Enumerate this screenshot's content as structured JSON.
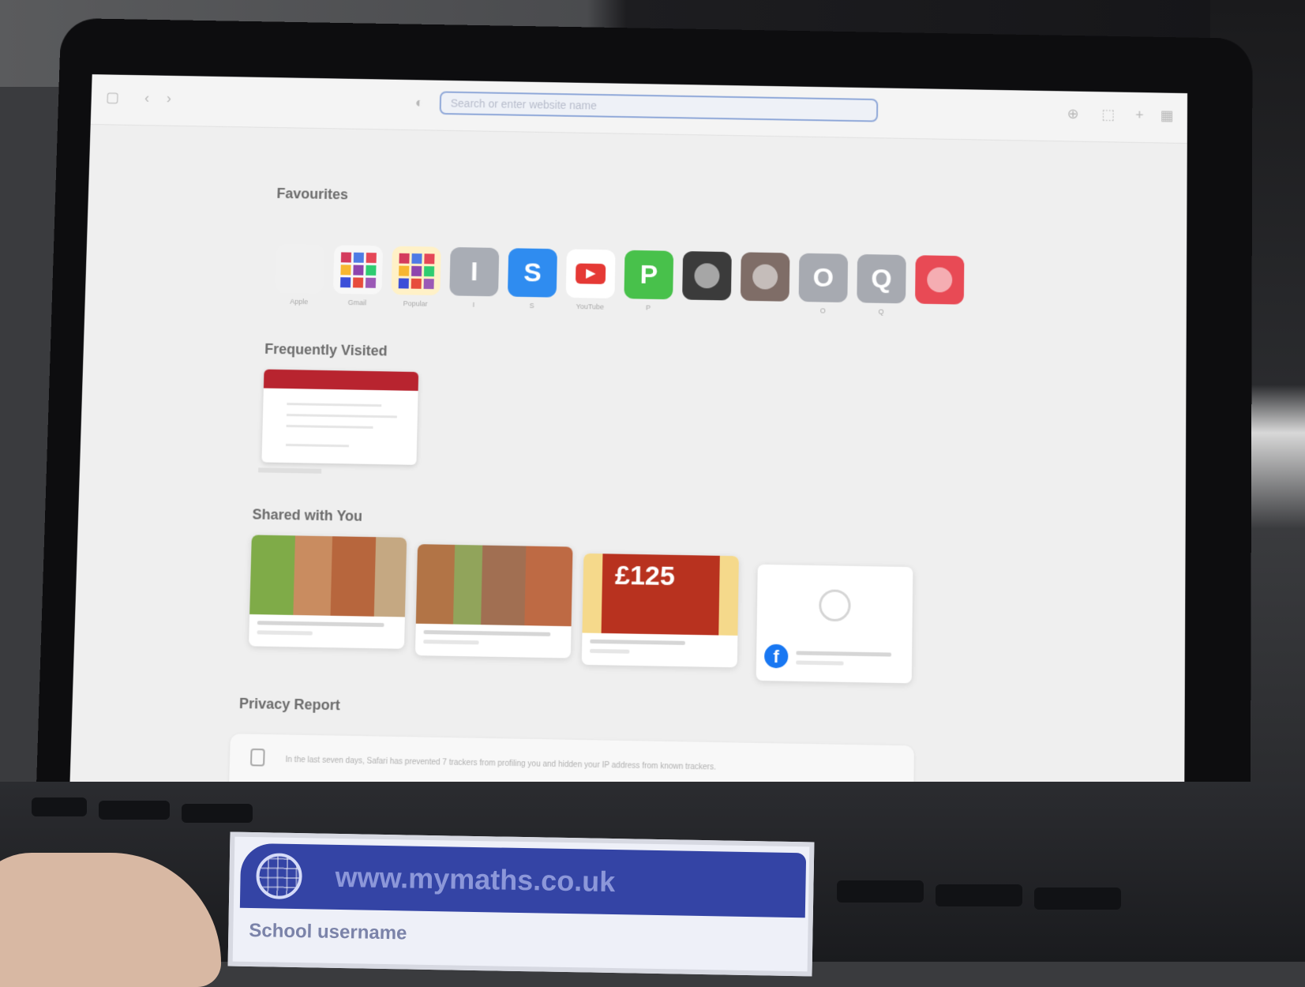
{
  "browser": {
    "address_placeholder": "Search or enter website name"
  },
  "sections": {
    "favourites": "Favourites",
    "frequently_visited": "Frequently Visited",
    "shared_with_you": "Shared with You",
    "privacy_report": "Privacy Report"
  },
  "favourites": [
    {
      "label": "Apple",
      "letter": "",
      "icon": "apple-icon",
      "color": "#f0f0f0"
    },
    {
      "label": "Gmail",
      "letter": "",
      "icon": "mosaic-icon",
      "color": "#f7f7f7"
    },
    {
      "label": "Popular",
      "letter": "",
      "icon": "mosaic-icon",
      "color": "#fff1c7"
    },
    {
      "label": "I",
      "letter": "I",
      "icon": "letter-icon",
      "color": "#a9adb5"
    },
    {
      "label": "S",
      "letter": "S",
      "icon": "letter-icon",
      "color": "#2f8cf0"
    },
    {
      "label": "YouTube",
      "letter": "▶",
      "icon": "youtube-icon",
      "color": "#ffffff"
    },
    {
      "label": "P",
      "letter": "P",
      "icon": "letter-icon",
      "color": "#48c14b"
    },
    {
      "label": "",
      "letter": "",
      "icon": "app-icon",
      "color": "#3b3b3b"
    },
    {
      "label": "",
      "letter": "",
      "icon": "app-icon",
      "color": "#7f6d67"
    },
    {
      "label": "O",
      "letter": "O",
      "icon": "letter-icon",
      "color": "#a7aab1"
    },
    {
      "label": "Q",
      "letter": "Q",
      "icon": "letter-icon",
      "color": "#a7aab1"
    },
    {
      "label": "",
      "letter": "",
      "icon": "app-icon",
      "color": "#e84a55"
    }
  ],
  "shared_cards": [
    {
      "price": ""
    },
    {
      "price": ""
    },
    {
      "price": "£125"
    },
    {
      "price": ""
    }
  ],
  "privacy": {
    "text": "In the last seven days, Safari has prevented 7 trackers from profiling you and hidden your IP address from known trackers."
  },
  "card": {
    "url": "www.mymaths.co.uk",
    "school_label": "School username"
  }
}
